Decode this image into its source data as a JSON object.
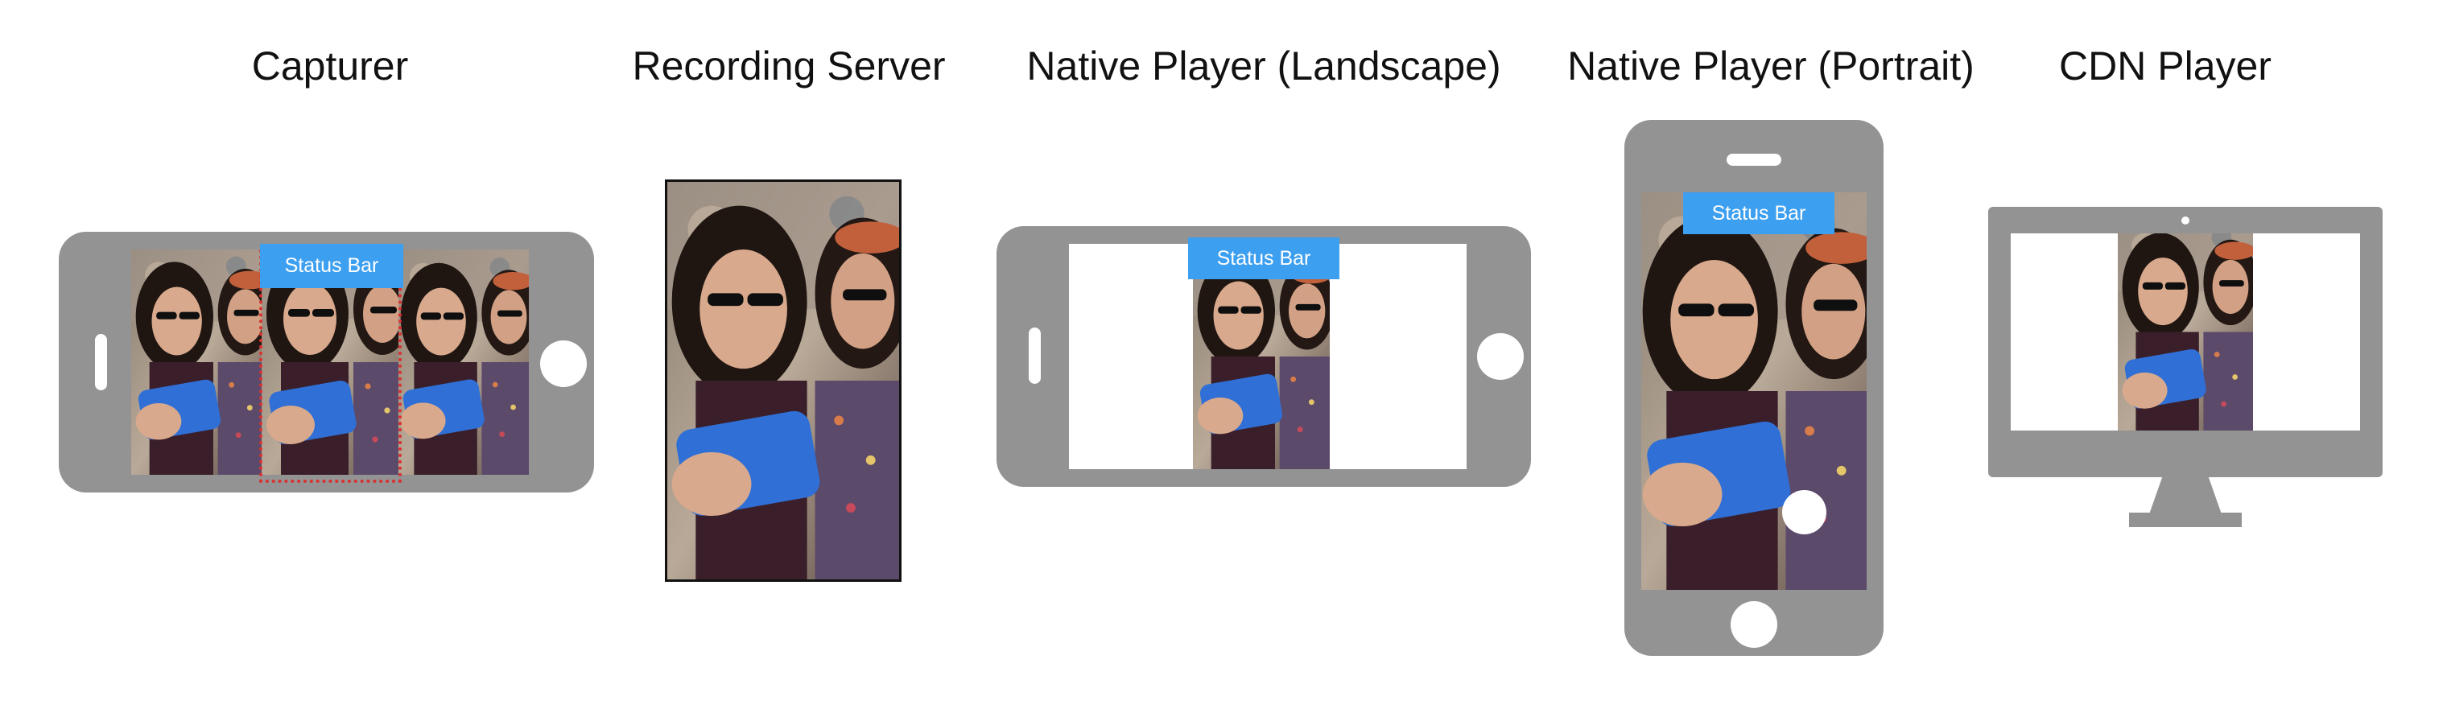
{
  "columns": {
    "capturer": "Capturer",
    "recording_server": "Recording Server",
    "native_landscape": "Native Player (Landscape)",
    "native_portrait": "Native Player (Portrait)",
    "cdn_player": "CDN Player"
  },
  "status_bar_label": "Status Bar",
  "colors": {
    "device_gray": "#939393",
    "status_bar_blue": "#3d9ff0",
    "crop_outline_red": "#d93030"
  },
  "icons": [
    "phone-landscape-icon",
    "phone-portrait-icon",
    "monitor-icon",
    "home-button-icon",
    "speaker-icon"
  ]
}
